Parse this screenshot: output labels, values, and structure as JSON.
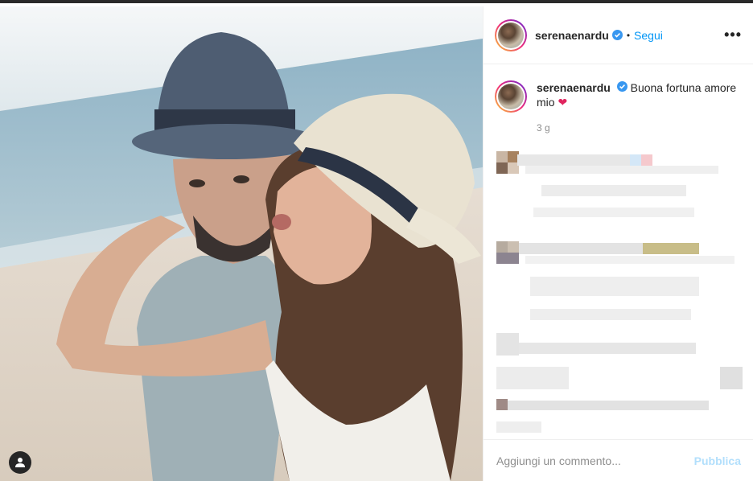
{
  "post": {
    "username": "serenaenardu",
    "verified_icon": "verified-badge-icon",
    "separator": "•",
    "follow_label": "Segui",
    "more_label": "•••"
  },
  "caption": {
    "username": "serenaenardu",
    "text": "Buona fortuna amore mio",
    "emoji": "❤",
    "time": "3 g"
  },
  "comment_box": {
    "placeholder": "Aggiungi un commento...",
    "publish_label": "Pubblica"
  },
  "colors": {
    "accent": "#0095f6",
    "publish_disabled": "#b2dffc",
    "meta_gray": "#8e8e8e",
    "heart": "#e0245e"
  }
}
